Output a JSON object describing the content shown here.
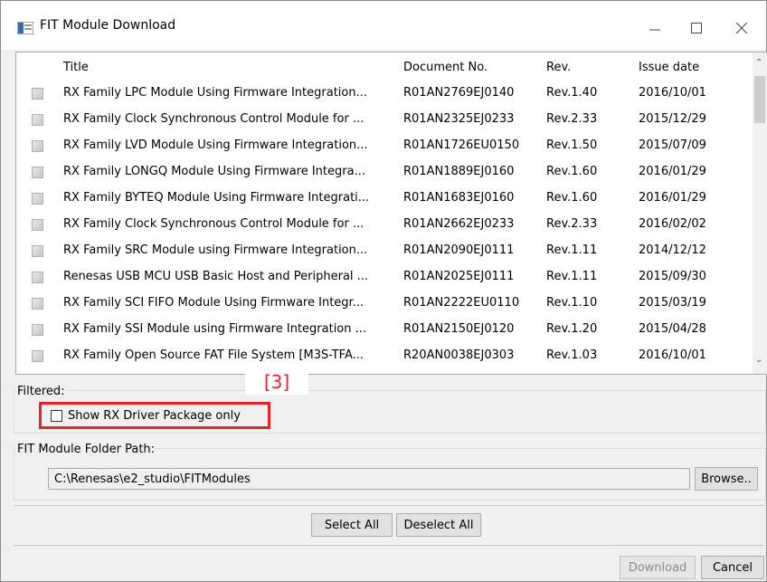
{
  "window": {
    "title": "FIT Module Download"
  },
  "table": {
    "columns": [
      "Title",
      "Document No.",
      "Rev.",
      "Issue date"
    ],
    "rows": [
      {
        "title": "RX Family LPC Module Using Firmware Integration...",
        "doc": "R01AN2769EJ0140",
        "rev": "Rev.1.40",
        "date": "2016/10/01"
      },
      {
        "title": "RX Family Clock Synchronous Control Module for ...",
        "doc": "R01AN2325EJ0233",
        "rev": "Rev.2.33",
        "date": "2015/12/29"
      },
      {
        "title": "RX Family LVD Module Using Firmware Integration...",
        "doc": "R01AN1726EU0150",
        "rev": "Rev.1.50",
        "date": "2015/07/09"
      },
      {
        "title": "RX Family LONGQ Module Using Firmware Integra...",
        "doc": "R01AN1889EJ0160",
        "rev": "Rev.1.60",
        "date": "2016/01/29"
      },
      {
        "title": "RX Family BYTEQ Module Using Firmware Integrati...",
        "doc": "R01AN1683EJ0160",
        "rev": "Rev.1.60",
        "date": "2016/01/29"
      },
      {
        "title": "RX Family Clock Synchronous Control Module for ...",
        "doc": "R01AN2662EJ0233",
        "rev": "Rev.2.33",
        "date": "2016/02/02"
      },
      {
        "title": "RX Family SRC Module using Firmware Integration...",
        "doc": "R01AN2090EJ0111",
        "rev": "Rev.1.11",
        "date": "2014/12/12"
      },
      {
        "title": "Renesas USB MCU USB Basic Host and Peripheral ...",
        "doc": "R01AN2025EJ0111",
        "rev": "Rev.1.11",
        "date": "2015/09/30"
      },
      {
        "title": "RX Family SCI FIFO Module Using Firmware Integr...",
        "doc": "R01AN2222EU0110",
        "rev": "Rev.1.10",
        "date": "2015/03/19"
      },
      {
        "title": "RX Family SSI Module using Firmware Integration ...",
        "doc": "R01AN2150EJ0120",
        "rev": "Rev.1.20",
        "date": "2015/04/28"
      },
      {
        "title": "RX Family Open Source FAT File System [M3S-TFA...",
        "doc": "R20AN0038EJ0303",
        "rev": "Rev.1.03",
        "date": "2016/10/01"
      }
    ]
  },
  "filter": {
    "label": "Filtered:",
    "checkbox_label": "Show RX Driver Package only",
    "checked": false,
    "annotation": "[3]"
  },
  "folder": {
    "label": "FIT Module Folder Path:",
    "value": "C:\\Renesas\\e2_studio\\FITModules",
    "browse": "Browse.."
  },
  "buttons": {
    "select_all": "Select All",
    "deselect_all": "Deselect All",
    "download": "Download",
    "cancel": "Cancel"
  },
  "colors": {
    "accent_annotation": "#e8232b"
  }
}
